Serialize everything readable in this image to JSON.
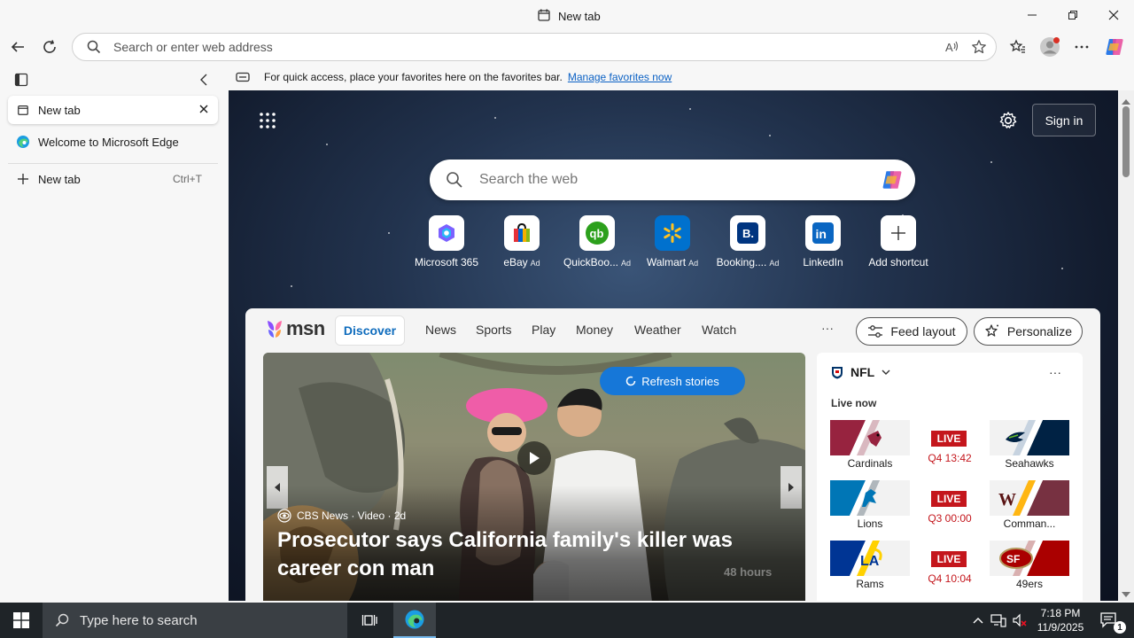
{
  "window": {
    "title": "New tab"
  },
  "toolbar": {
    "address_placeholder": "Search or enter web address"
  },
  "sidebar": {
    "tabs": [
      {
        "label": "New tab",
        "active": true
      },
      {
        "label": "Welcome to Microsoft Edge",
        "active": false
      }
    ],
    "new_tab_label": "New tab",
    "new_tab_shortcut": "Ctrl+T"
  },
  "favbar": {
    "message": "For quick access, place your favorites here on the favorites bar.",
    "link": "Manage favorites now"
  },
  "newtab": {
    "signin_label": "Sign in",
    "search_placeholder": "Search the web",
    "shortcuts": [
      {
        "label": "Microsoft 365",
        "ad": ""
      },
      {
        "label": "eBay",
        "ad": "Ad"
      },
      {
        "label": "QuickBoo...",
        "ad": "Ad"
      },
      {
        "label": "Walmart",
        "ad": "Ad"
      },
      {
        "label": "Booking....",
        "ad": "Ad"
      },
      {
        "label": "LinkedIn",
        "ad": ""
      },
      {
        "label": "Add shortcut",
        "ad": ""
      }
    ]
  },
  "msn": {
    "logo": "msn",
    "tabs": [
      "Discover",
      "News",
      "Sports",
      "Play",
      "Money",
      "Weather",
      "Watch"
    ],
    "more": "···",
    "feed_layout": "Feed layout",
    "personalize": "Personalize",
    "hero": {
      "refresh": "Refresh stories",
      "source": "CBS News · Video · 2d",
      "title": "Prosecutor says California family's killer was career con man",
      "watermark": "48 hours"
    },
    "nfl": {
      "title": "NFL",
      "more": "···",
      "live_now": "Live now",
      "live_label": "LIVE",
      "games": [
        {
          "home": "Cardinals",
          "away": "Seahawks",
          "clock": "Q4 13:42",
          "home_color": "#97233f",
          "away_color": "#002244"
        },
        {
          "home": "Lions",
          "away": "Comman...",
          "clock": "Q3 00:00",
          "home_color": "#0076b6",
          "away_color": "#773141"
        },
        {
          "home": "Rams",
          "away": "49ers",
          "clock": "Q4 10:04",
          "home_color": "#003594",
          "away_color": "#aa0000"
        }
      ]
    }
  },
  "taskbar": {
    "search_placeholder": "Type here to search",
    "time": "7:18 PM",
    "date": "11/9/2025",
    "notif_count": "1"
  },
  "colors": {
    "accent": "#0f6cbd",
    "live": "#c4161c",
    "taskbar": "#1f2428"
  }
}
